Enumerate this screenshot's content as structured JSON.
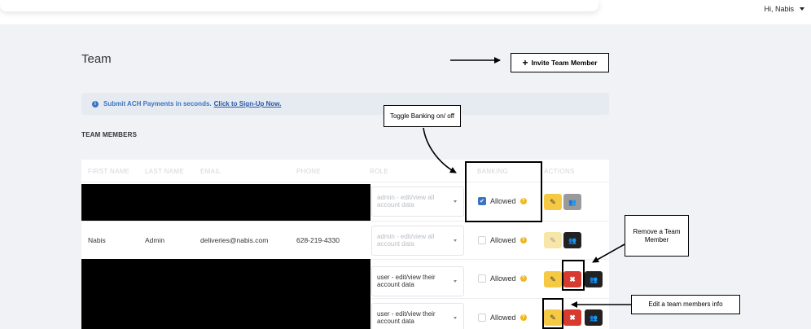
{
  "header": {
    "greeting": "Hi, Nabis"
  },
  "page": {
    "title": "Team"
  },
  "invite_button": {
    "plus": "+",
    "label": "Invite Team Member"
  },
  "banner": {
    "icon": "info-icon",
    "text": "Submit ACH Payments in seconds.",
    "link": "Click to Sign-Up Now."
  },
  "section": {
    "title": "TEAM MEMBERS"
  },
  "table": {
    "headers": [
      "FIRST NAME",
      "LAST NAME",
      "EMAIL",
      "PHONE",
      "ROLE",
      "BANKING",
      "ACTIONS"
    ],
    "rows": [
      {
        "first_name": "",
        "last_name": "",
        "email": "",
        "phone": "",
        "role": "admin - edit/view all account data",
        "banking_label": "Allowed",
        "banking_checked": true,
        "question_icon": "?",
        "edit_icon": "✎",
        "team_icon": "👥"
      },
      {
        "first_name": "Nabis",
        "last_name": "Admin",
        "email": "deliveries@nabis.com",
        "phone": "628-219-4330",
        "role": "admin - edit/view all account data",
        "banking_label": "Allowed",
        "banking_checked": false,
        "question_icon": "?",
        "edit_icon": "✎",
        "team_icon": "👥"
      },
      {
        "first_name": "",
        "last_name": "",
        "email": "",
        "phone": "",
        "role": "user - edit/view their account data",
        "banking_label": "Allowed",
        "banking_checked": false,
        "question_icon": "?",
        "edit_icon": "✎",
        "delete_icon": "✖",
        "team_icon": "👥"
      },
      {
        "first_name": "",
        "last_name": "",
        "email": "",
        "phone": "",
        "role": "user - edit/view their account data",
        "banking_label": "Allowed",
        "banking_checked": false,
        "question_icon": "?",
        "edit_icon": "✎",
        "delete_icon": "✖",
        "team_icon": "👥"
      }
    ]
  },
  "annotations": {
    "toggle_banking": "Toggle Banking on/ off",
    "remove_member": "Remove a Team Member",
    "edit_member": "Edit a team members info"
  },
  "colors": {
    "accent_blue": "#3b74c4",
    "edit_yellow": "#f6c944",
    "delete_red": "#d73b2f",
    "help_orange": "#f2b61c"
  }
}
